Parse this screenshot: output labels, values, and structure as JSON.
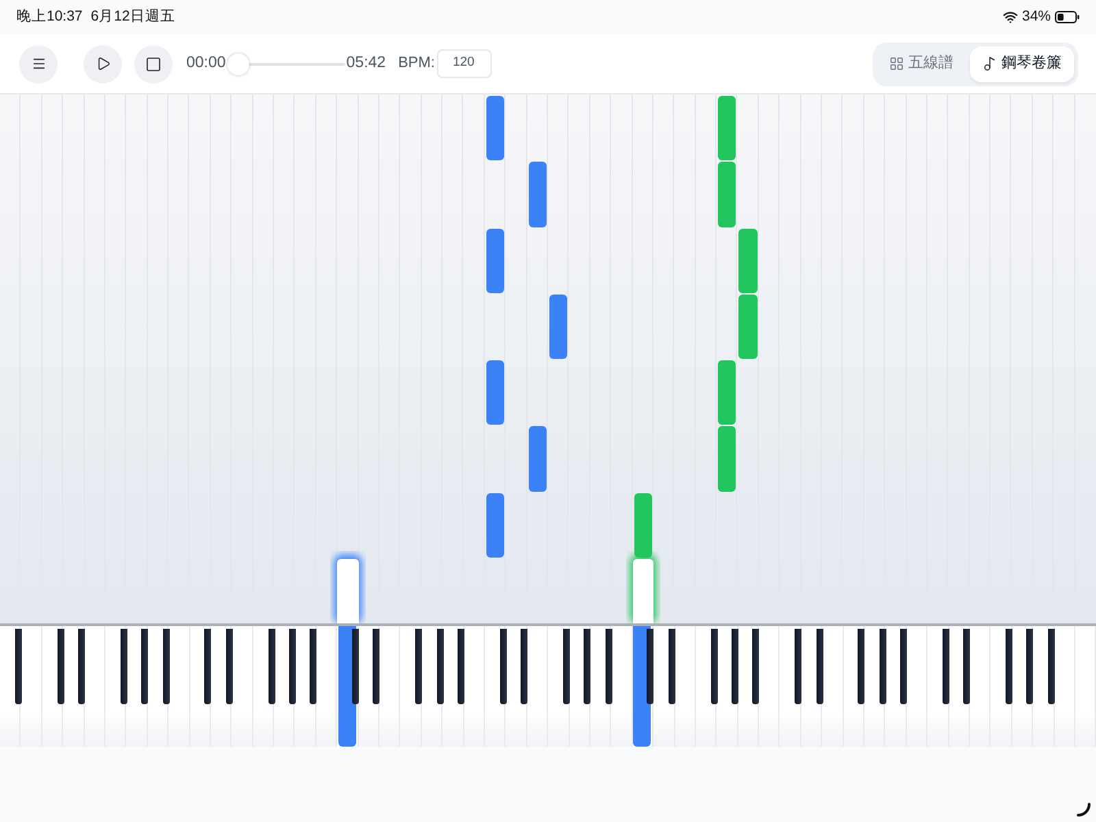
{
  "status_bar": {
    "time": "晚上10:37",
    "date": "6月12日週五",
    "battery": "34%"
  },
  "toolbar": {
    "current_time": "00:00",
    "progress": {
      "level": 0
    },
    "total_time": "05:42",
    "bpm": {
      "label": "BPM:",
      "value": "120"
    }
  },
  "view_tabs": [
    {
      "kind": "staff",
      "label": "五線譜",
      "selected": false
    },
    {
      "kind": "roll",
      "label": "鋼琴卷簾",
      "selected": true
    }
  ]
}
